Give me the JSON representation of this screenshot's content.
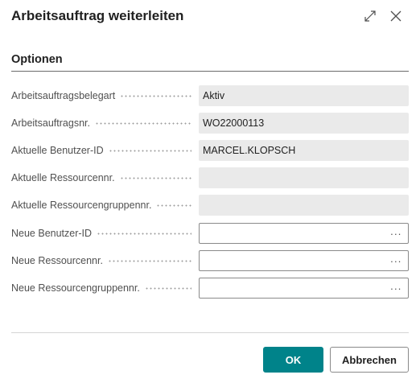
{
  "dialog": {
    "title": "Arbeitsauftrag weiterleiten",
    "section_title": "Optionen"
  },
  "fields": [
    {
      "label": "Arbeitsauftragsbelegart",
      "value": "Aktiv"
    },
    {
      "label": "Arbeitsauftragsnr.",
      "value": "WO22000113"
    },
    {
      "label": "Aktuelle Benutzer-ID",
      "value": "MARCEL.KLOPSCH"
    },
    {
      "label": "Aktuelle Ressourcennr.",
      "value": ""
    },
    {
      "label": "Aktuelle Ressourcengruppennr.",
      "value": ""
    },
    {
      "label": "Neue Benutzer-ID",
      "value": ""
    },
    {
      "label": "Neue Ressourcennr.",
      "value": ""
    },
    {
      "label": "Neue Ressourcengruppennr.",
      "value": ""
    }
  ],
  "lookup_glyph": "···",
  "buttons": {
    "ok": "OK",
    "cancel": "Abbrechen"
  },
  "colors": {
    "primary": "#00838a",
    "readonly_bg": "#eaeaea"
  },
  "icons": {
    "expand": "expand-icon",
    "close": "close-icon"
  }
}
